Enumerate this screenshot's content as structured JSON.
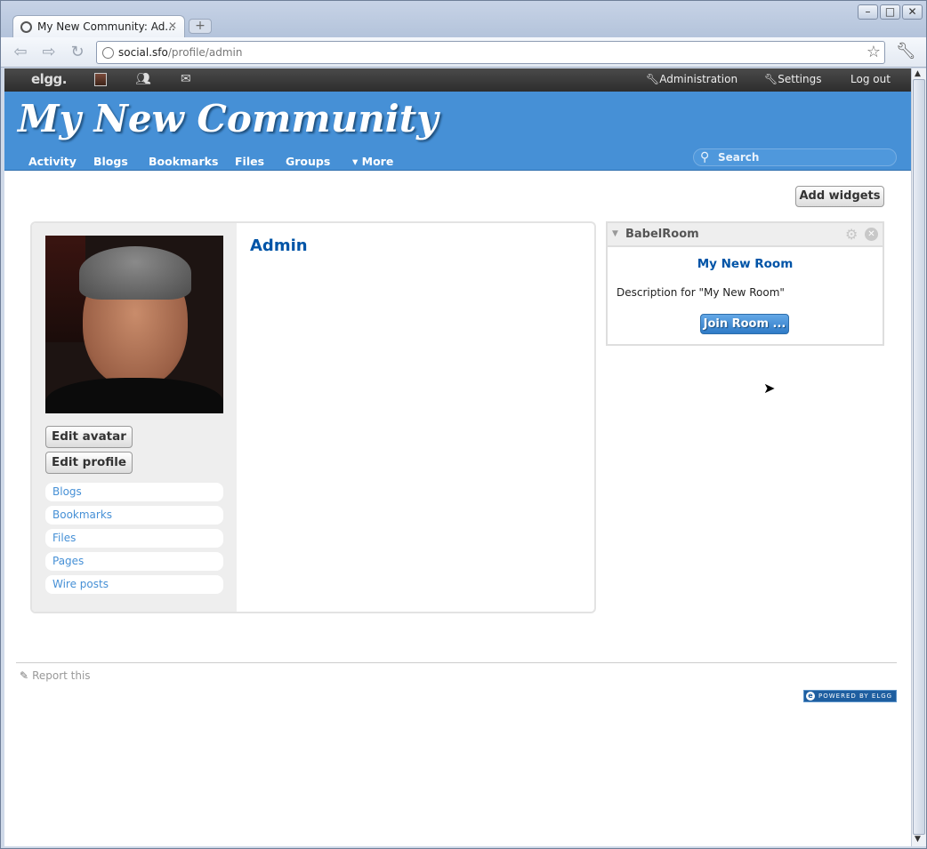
{
  "browser": {
    "tab_title": "My New Community: Ad...",
    "tab_close": "✕",
    "new_tab": "+",
    "url_host": "social.sfo",
    "url_path": "/profile/admin",
    "controls": {
      "minimize": "–",
      "maximize": "□",
      "close": "✕"
    }
  },
  "topbar": {
    "logo": "elgg.",
    "links": {
      "administration": "Administration",
      "settings": "Settings",
      "logout": "Log out"
    }
  },
  "site": {
    "title": "My New Community",
    "menu": [
      "Activity",
      "Blogs",
      "Bookmarks",
      "Files",
      "Groups",
      "▾ More"
    ],
    "search_placeholder": "Search"
  },
  "page": {
    "add_widgets": "Add widgets",
    "profile": {
      "name": "Admin",
      "buttons": {
        "edit_avatar": "Edit avatar",
        "edit_profile": "Edit profile"
      },
      "links": [
        "Blogs",
        "Bookmarks",
        "Files",
        "Pages",
        "Wire posts"
      ]
    },
    "widget": {
      "title": "BabelRoom",
      "room_title": "My New Room",
      "description": "Description for \"My New Room\"",
      "join": "Join Room ..."
    },
    "footer": {
      "report": "Report this",
      "powered": "POWERED BY ELGG",
      "powered_logo": "e"
    }
  },
  "colors": {
    "header": "#4690d6",
    "link": "#0054a7",
    "topbar": "#333333"
  }
}
